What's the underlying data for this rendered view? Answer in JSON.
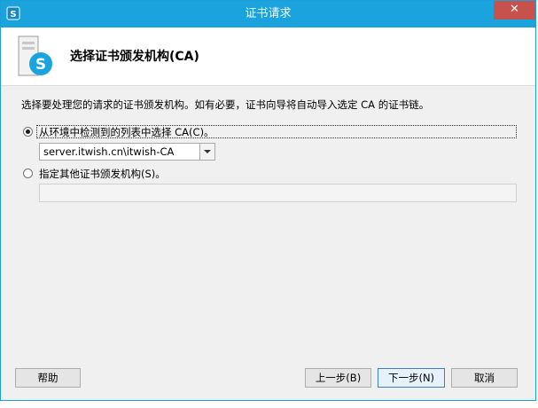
{
  "window": {
    "title": "证书请求",
    "close_label": "✕"
  },
  "header": {
    "title": "选择证书颁发机构(CA)"
  },
  "body": {
    "description": "选择要处理您的请求的证书颁发机构。如有必要，证书向导将自动导入选定 CA 的证书链。",
    "option_detect_label": "从环境中检测到的列表中选择 CA(C)。",
    "option_detect_checked": true,
    "ca_select_value": "server.itwish.cn\\itwish-CA",
    "option_specify_label": "指定其他证书颁发机构(S)。",
    "option_specify_checked": false,
    "specify_field_value": ""
  },
  "footer": {
    "help_label": "帮助",
    "back_label": "上一步(B)",
    "next_label": "下一步(N)",
    "cancel_label": "取消"
  },
  "colors": {
    "titlebar": "#1aa3dd",
    "close_button": "#c7514d",
    "dialog_background": "#f0f0f0"
  },
  "icons": [
    "certificate-icon",
    "skype-server-icon",
    "close-icon",
    "dropdown-arrow-icon"
  ]
}
